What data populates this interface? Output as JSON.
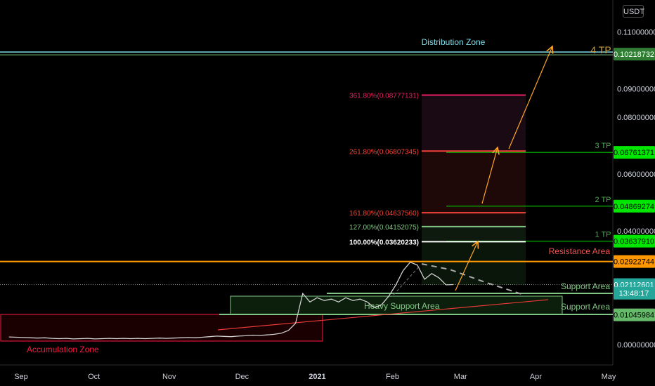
{
  "currency": "USDT",
  "chart_data": {
    "type": "line",
    "series": [
      {
        "values": [
          0.0027,
          0.0026,
          0.0025,
          0.0024,
          0.0023,
          0.0024,
          0.0022,
          0.0021,
          0.0022,
          0.002,
          0.0021,
          0.0022,
          0.002,
          0.0021,
          0.0022,
          0.0021,
          0.0022,
          0.0021,
          0.0022,
          0.0021,
          0.0022,
          0.0023,
          0.0022,
          0.0023,
          0.0024,
          0.0025,
          0.0024,
          0.0026,
          0.0028,
          0.003,
          0.0029,
          0.0028,
          0.003,
          0.0031,
          0.0033,
          0.0032,
          0.0034,
          0.0036,
          0.004,
          0.005,
          0.0075,
          0.018,
          0.015,
          0.0165,
          0.0155,
          0.016,
          0.015,
          0.0165,
          0.0155,
          0.016,
          0.015,
          0.013,
          0.014,
          0.017,
          0.021,
          0.026,
          0.029,
          0.028,
          0.023,
          0.025,
          0.0235,
          0.021,
          0.0211
        ],
        "x_start": "2020-08-27",
        "x_end": "2021-02-26"
      }
    ],
    "x_ticks": [
      "Sep",
      "Oct",
      "Nov",
      "Dec",
      "2021",
      "Feb",
      "Mar",
      "Apr",
      "May"
    ],
    "y_ticks": [
      "0.11000000",
      "0.09000000",
      "0.08000000",
      "0.06000000",
      "0.04000000",
      "0.00000000"
    ],
    "ylim": [
      -0.0015,
      0.1125
    ],
    "price_labels": [
      {
        "text": "0.10218732",
        "value": 0.10218732,
        "bg": "#2e7d32",
        "fg": "#ffffff"
      },
      {
        "text": "0.06761371",
        "value": 0.06761371,
        "bg": "#00e600",
        "fg": "#000000"
      },
      {
        "text": "0.04869274",
        "value": 0.04869274,
        "bg": "#00e600",
        "fg": "#000000"
      },
      {
        "text": "0.03637910",
        "value": 0.0363791,
        "bg": "#00e600",
        "fg": "#000000"
      },
      {
        "text": "0.02922744",
        "value": 0.02922744,
        "bg": "#ff9800",
        "fg": "#000000"
      },
      {
        "text": "0.02112601",
        "value": 0.02112601,
        "bg": "#26a69a",
        "fg": "#ffffff"
      },
      {
        "text": "13:48:17",
        "value": 0.0181,
        "bg": "#26a69a",
        "fg": "#ffffff"
      },
      {
        "text": "0.01045984",
        "value": 0.01045984,
        "bg": "#66bb6a",
        "fg": "#000000"
      }
    ],
    "fib_levels": [
      {
        "label": "361.80%(0.08777131)",
        "value": 0.08777131,
        "color": "#e91e63"
      },
      {
        "label": "261.80%(0.06807345)",
        "value": 0.06807345,
        "color": "#f44336"
      },
      {
        "label": "161.80%(0.04637560)",
        "value": 0.0463756,
        "color": "#f44336"
      },
      {
        "label": "127.00%(0.04152075)",
        "value": 0.04152075,
        "color": "#81c784"
      },
      {
        "label": "100.00%(0.03620233)",
        "value": 0.03620233,
        "color": "#ffffff"
      }
    ],
    "annotations": {
      "distribution_zone": "Distribution Zone",
      "tp4": "4 TP",
      "tp3": "3 TP",
      "tp2": "2 TP",
      "tp1": "1 TP",
      "resistance_area": "Resistance Area",
      "support_area_upper": "Support Area",
      "support_area_lower": "Support Area",
      "heavy_support_area": "Heavy Support Area",
      "accumulation_zone": "Accumulation Zone"
    },
    "colors": {
      "distribution": "#80deea",
      "resistance": "#ff9800",
      "support": "#81c784",
      "tp_line": "#00e600",
      "accumulation": "#ff1744",
      "trend": "#e53935",
      "arrow": "#ffa726",
      "price_line": "#26a69a"
    }
  }
}
